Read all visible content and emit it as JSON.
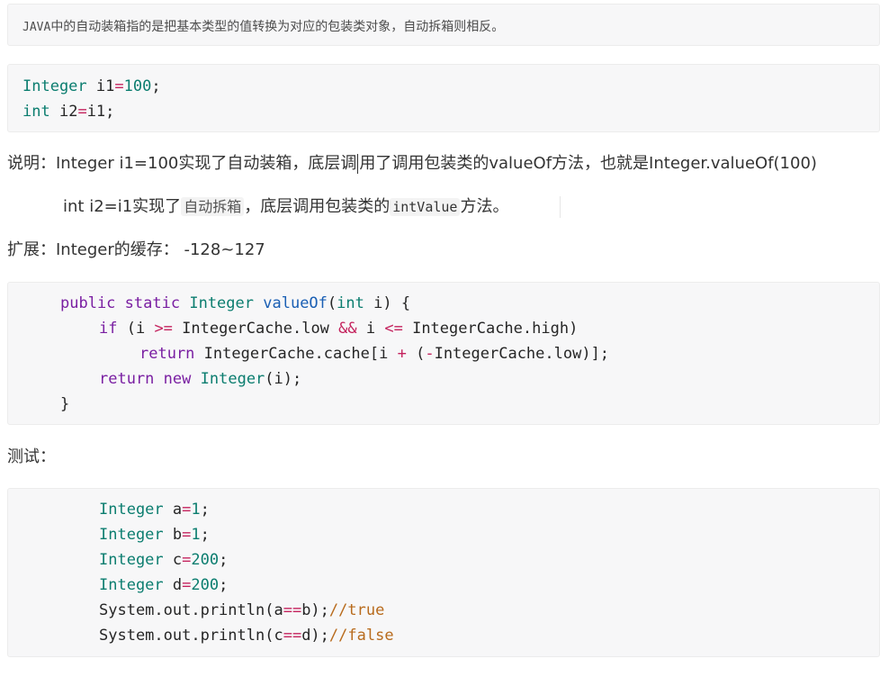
{
  "intro": {
    "prefix": "JAVA",
    "text": "中的自动装箱指的是把基本类型的值转换为对应的包装类对象，自动拆箱则相反。"
  },
  "code1": {
    "l1": [
      "Integer",
      " i1",
      "=",
      "100",
      ";"
    ],
    "l2": [
      "int",
      " i2",
      "=",
      "i1;"
    ]
  },
  "explain": {
    "a": "说明：Integer i1=100实现了自动装箱，底层调",
    "b": "用了调用包装类的valueOf方法，也就是Integer.valueOf(100)"
  },
  "explain2": {
    "a": "int i2=i1实现了",
    "hl": "自动拆箱",
    "b": "，底层调用包装类的",
    "code": "intValue",
    "c": "方法。"
  },
  "ext": {
    "text": "扩展：Integer的缓存： -128~127"
  },
  "code2": {
    "l1": {
      "kw1": "public",
      "kw2": "static",
      "type": "Integer",
      "fn": "valueOf",
      "p1": "(",
      "pt": "int",
      "p2": " i) {"
    },
    "l2": {
      "kw": "if",
      "a": " (i ",
      "op1": ">=",
      "b": " IntegerCache.low ",
      "op2": "&&",
      "c": " i ",
      "op3": "<=",
      "d": " IntegerCache.high)"
    },
    "l3": {
      "kw": "return",
      "a": " IntegerCache.cache[i ",
      "op": "+",
      "b": " (",
      "op2": "-",
      "c": "IntegerCache.low)];"
    },
    "l4": {
      "kw": "return",
      "kw2": "new",
      "type": "Integer",
      "a": "(i);"
    },
    "l5": "}"
  },
  "test": {
    "label": "测试："
  },
  "code3": {
    "lines": [
      {
        "type": "Integer",
        "var": " a",
        "op": "=",
        "num": "1",
        "end": ";"
      },
      {
        "type": "Integer",
        "var": " b",
        "op": "=",
        "num": "1",
        "end": ";"
      },
      {
        "type": "Integer",
        "var": " c",
        "op": "=",
        "num": "200",
        "end": ";"
      },
      {
        "type": "Integer",
        "var": " d",
        "op": "=",
        "num": "200",
        "end": ";"
      }
    ],
    "p1": {
      "a": "System.out.println(a",
      "op": "==",
      "b": "b);",
      "cmt": "//true"
    },
    "p2": {
      "a": "System.out.println(c",
      "op": "==",
      "b": "d);",
      "cmt": "//false"
    }
  }
}
